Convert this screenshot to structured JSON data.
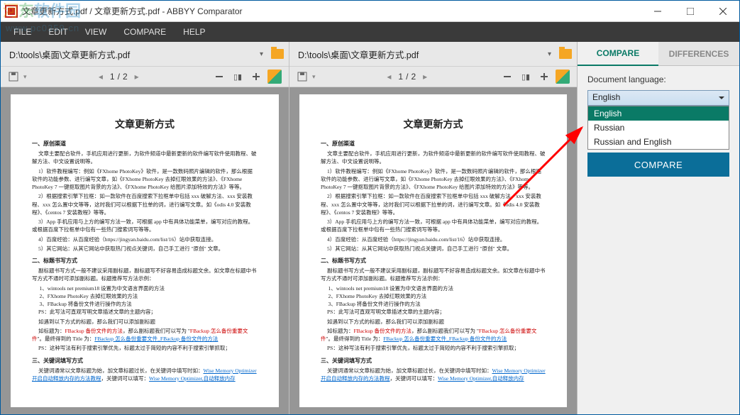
{
  "window": {
    "title": "文章更新方式.pdf / 文章更新方式.pdf - ABBYY Comparator"
  },
  "menu": {
    "file": "FILE",
    "edit": "EDIT",
    "view": "VIEW",
    "compare": "COMPARE",
    "help": "HELP"
  },
  "panes": [
    {
      "path": "D:\\tools\\桌面\\文章更新方式.pdf",
      "page_current": "1",
      "page_sep": "/",
      "page_total": "2"
    },
    {
      "path": "D:\\tools\\桌面\\文章更新方式.pdf",
      "page_current": "1",
      "page_sep": "/",
      "page_total": "2"
    }
  ],
  "document": {
    "title": "文章更新方式",
    "sec1": "一、原创渠道",
    "p1": "文章主要配合软件，手机应用进行更新，为软件频道中最新更新的软件编写软件使用教程、破解方法、中文设置说明等。",
    "p2": "1）软件教程编写：例如《FXhome PhotoKey》软件，是一款数码照片编辑的软件，那么根据软件的功能参数、进行编写文章，如《FXhome PhotoKey 去掉红眼效果的方法》、《FXhome PhotoKey 7 一键抠取图片背景的方法》、《FXhome PhotoKey 给图片添加特效的方法》等等。",
    "p3": "2）根据搜索引擎下拉框：如一款软件在百度搜索下拉框单中包括 xxx 破解方法、xxx 安装教程、xxx 怎么置中文等等，这时我们可以根据下拉单的词，进行编写文章。如《odis 4.0 安装教程》、《centos 7 安装教程》等等。",
    "p4": "3）App 手机应用与上方的编写方法一致，可根据 app 中有具体功能菜单，编写对应的教程。或根据百度下拉框单中包有一些热门搜索词写等等。",
    "p5": "4）百度经验：从百度经验（https://jingyan.baidu.com/list/16）站中获取连接。",
    "p6": "5）其它网站：从其它网站中获取热门视点关键词，自己手工进行 \"原创\" 文章。",
    "sec2": "二、标题书写方式",
    "p7": "副标题书写方式一般不建议采用副标题，副标题写不好容易造成标题文余。如文章在标题中书写方式不通时可添加副标题。标题推荐写方法示例：",
    "i1": "1、wintools net premium18 设置为中文语言界面的方法",
    "i2": "2、FXhome PhotoKey 去掉红眼效果的方法",
    "i3": "3、FBackup 将备份文件进行操作的方法",
    "ps1": "PS：此写法可直观写明文章插述文章的主题内容；",
    "q1": "如遇到以下方式的标题，那么我们可以添加副标题",
    "q2a": "如标题为：",
    "q2r": "FBackup 备份文件的方法",
    "q2b": "，那么副标题我们可以写为 \"",
    "q2r2": "FBackup 怎么备份重要文件",
    "q2c": "\"。最终得到的 Title 为：",
    "q2u": "FBackup 怎么备份重要文件_FBackup 备份文件的方法",
    "ps2": "PS：这种写法有利于搜索引擎优先，标题太过于简短的内容不利于搜索引擎抓取；",
    "sec3": "三、关键词填写方式",
    "p8a": "关键词通常以文章标题为始，加文章标题过长，在关键词中填写时如：",
    "p8u": "Wise Memory Optimizer 开启自动释放内存的方法教程",
    "p8b": "，关键词可以填写：",
    "p8u2": "Wise Memory Optimizer,自动释放内存"
  },
  "sidebar": {
    "tab_compare": "COMPARE",
    "tab_diff": "DIFFERENCES",
    "lang_label": "Document language:",
    "lang_value": "English",
    "options": [
      "English",
      "Russian",
      "Russian and English"
    ],
    "button": "COMPARE"
  },
  "watermark": {
    "url": "www.pc0359.cn",
    "brand": "河东软件园"
  }
}
